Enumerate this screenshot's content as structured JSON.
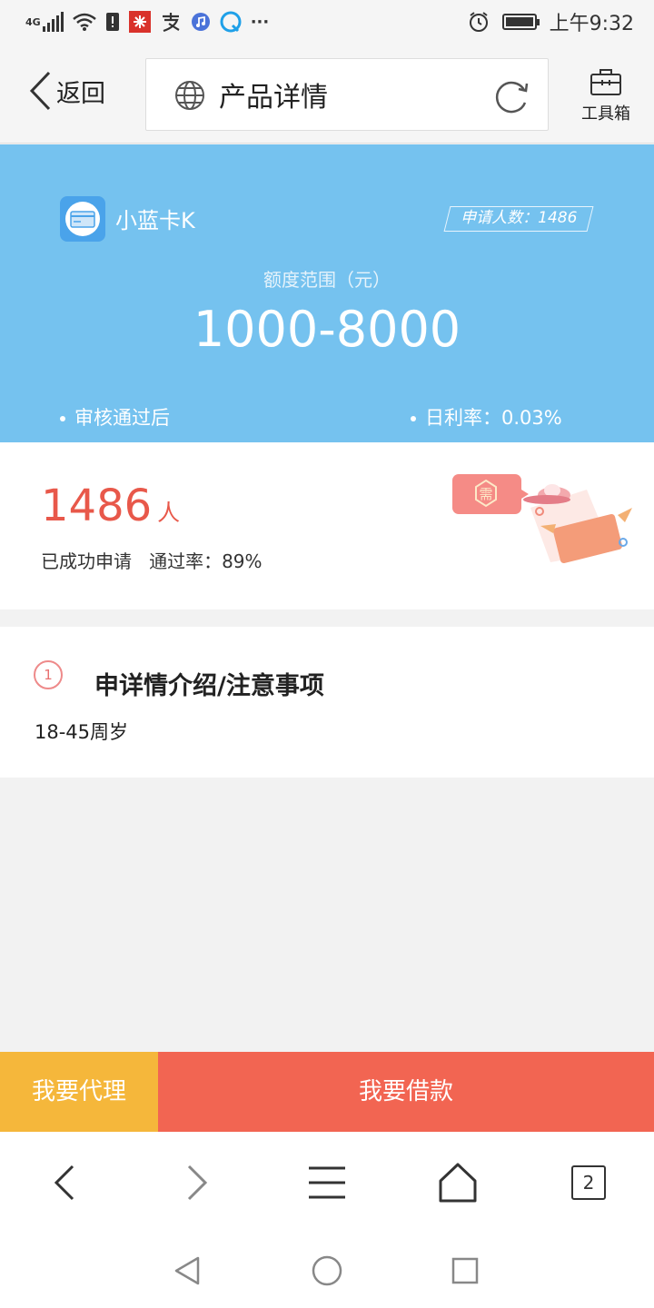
{
  "status_bar": {
    "network": "4G",
    "time": "上午9:32",
    "icons": [
      "signal-icon",
      "wifi-icon",
      "sim-icon",
      "app-icon",
      "alipay-icon",
      "music-icon",
      "browser-icon",
      "more-icon",
      "alarm-icon",
      "battery-icon"
    ]
  },
  "nav": {
    "back_label": "返回",
    "title": "产品详情",
    "toolbox_label": "工具箱"
  },
  "product": {
    "name": "小蓝卡K",
    "applicants_badge": "申请人数：1486",
    "range_label": "额度范围（元）",
    "range_value": "1000-8000",
    "review_note": "审核通过后",
    "daily_rate": "日利率：0.03%"
  },
  "stats": {
    "count": "1486",
    "unit": "人",
    "success_label": "已成功申请",
    "pass_rate": "通过率：89%",
    "badge_char": "需"
  },
  "intro": {
    "index": "1",
    "title": "申详情介绍/注意事项",
    "text": "18-45周岁"
  },
  "actions": {
    "agent_label": "我要代理",
    "borrow_label": "我要借款"
  },
  "browser": {
    "tab_count": "2"
  },
  "colors": {
    "card_blue": "#75c2ef",
    "accent_red": "#f26552",
    "agent_yellow": "#f5b73b",
    "count_red": "#e8584a"
  }
}
